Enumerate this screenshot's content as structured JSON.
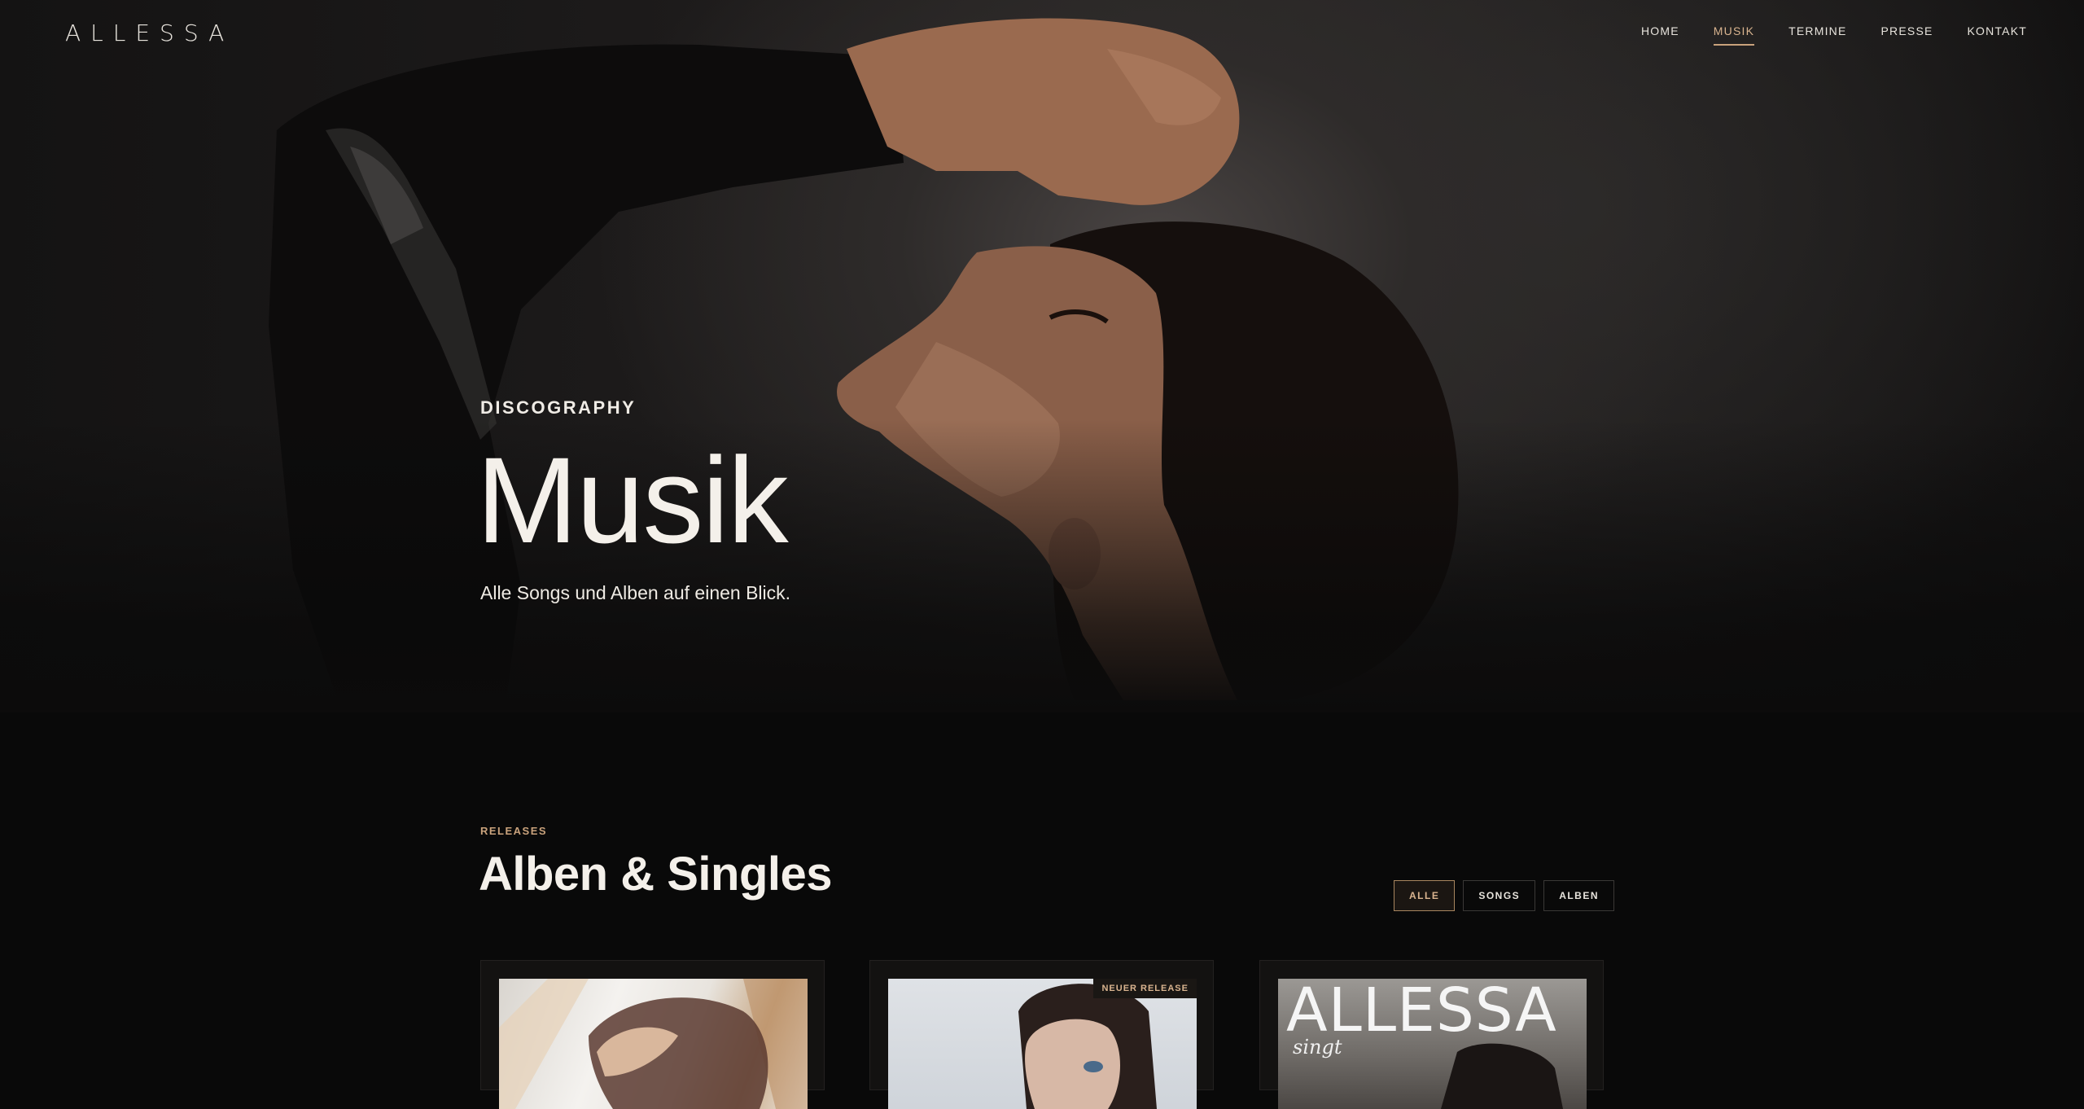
{
  "brand": {
    "logo_text": "ALLESSA"
  },
  "nav": {
    "items": [
      {
        "label": "HOME",
        "active": false
      },
      {
        "label": "MUSIK",
        "active": true
      },
      {
        "label": "TERMINE",
        "active": false
      },
      {
        "label": "PRESSE",
        "active": false
      },
      {
        "label": "KONTAKT",
        "active": false
      }
    ]
  },
  "hero": {
    "eyebrow": "DISCOGRAPHY",
    "title": "Musik",
    "subtitle": "Alle Songs und Alben auf einen Blick."
  },
  "releases": {
    "eyebrow": "RELEASES",
    "title": "Alben & Singles",
    "filters": [
      {
        "label": "ALLE",
        "active": true
      },
      {
        "label": "SONGS",
        "active": false
      },
      {
        "label": "ALBEN",
        "active": false
      }
    ],
    "cards": [
      {
        "badge": ""
      },
      {
        "badge": "NEUER RELEASE"
      },
      {
        "badge": "",
        "cover_title": "ALLESSA",
        "cover_sub": "singt"
      }
    ]
  },
  "colors": {
    "accent": "#c9a27c",
    "background": "#090909",
    "text": "#f2efe9"
  }
}
